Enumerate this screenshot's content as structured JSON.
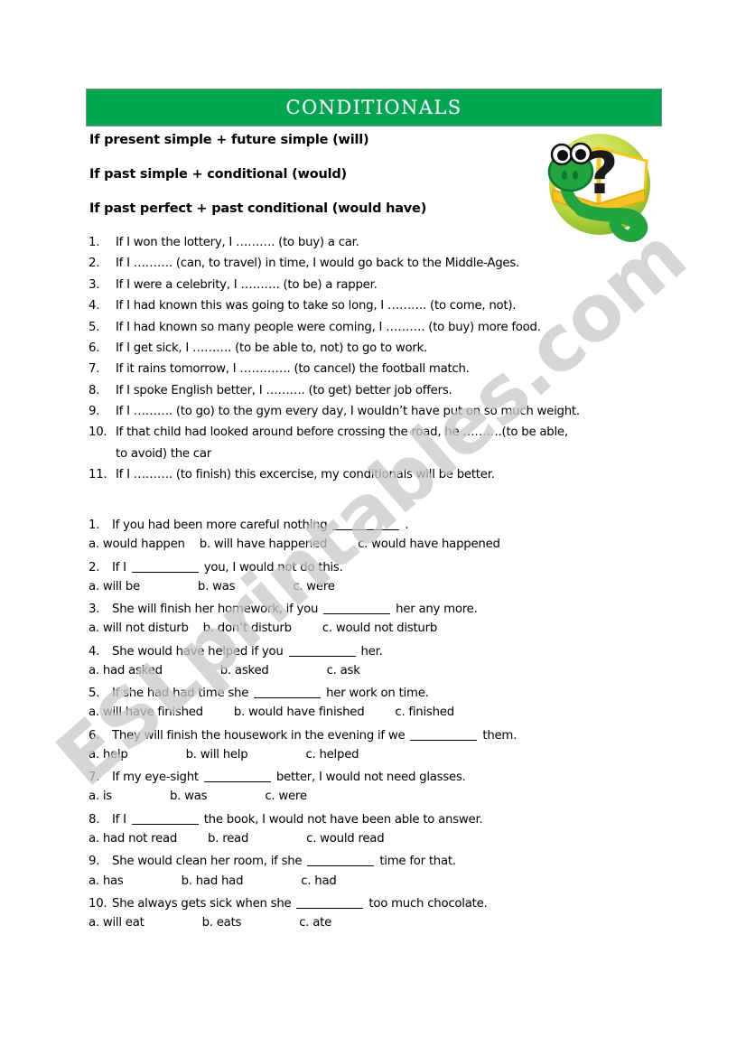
{
  "page": {
    "background_color": "#ffffff",
    "watermark": "ESLprintables.com"
  },
  "banner": {
    "title": "CONDITIONALS",
    "background_color": "#00a64f",
    "text_color": "#ffffff"
  },
  "clipart": {
    "name": "snake-with-book-question-mark",
    "circle_color": "#b5d334",
    "snake_color": "#15a03c",
    "book_color": "#ffffff",
    "book_edge_color": "#f5c518",
    "question_mark": "?"
  },
  "rules": [
    "If present simple + future simple (will)",
    "If past simple + conditional (would)",
    "If past perfect + past conditional (would have)"
  ],
  "exercise_one": {
    "items": [
      {
        "number": "1.",
        "text": "If I won the lottery, I ………. (to buy) a car."
      },
      {
        "number": "2.",
        "text": "If I ………. (can, to travel) in time, I would go back to the Middle-Ages."
      },
      {
        "number": "3.",
        "text": "If I were a celebrity, I ………. (to be) a rapper."
      },
      {
        "number": "4.",
        "text": "If I had known this was going to take so long, I ………. (to come, not)."
      },
      {
        "number": "5.",
        "text": "If I had known so many people were coming, I ………. (to buy) more food."
      },
      {
        "number": "6.",
        "text": "If I get sick, I ………. (to be able to, not) to go to work."
      },
      {
        "number": "7.",
        "text": "If it rains tomorrow, I …………. (to cancel) the football match."
      },
      {
        "number": "8.",
        "text": "If I spoke English better, I ………. (to get) better job offers."
      },
      {
        "number": "9.",
        "text": "If I ………. (to go) to the gym every day, I wouldn’t have put on so much weight."
      },
      {
        "number": "10.",
        "text": "If that child had looked around before crossing the road, he ……….(to be able, ",
        "continuation": "to avoid) the car"
      },
      {
        "number": "11.",
        "text": "If I ………. (to finish) this excercise, my conditionals will be better."
      }
    ]
  },
  "exercise_two": {
    "questions": [
      {
        "number": "1.",
        "stem_before": "If you had been more careful nothing",
        "stem_after": ".",
        "options": [
          "a. would happen",
          "b. will have happened",
          "c. would have happened"
        ],
        "gaps": [
          "sm",
          "md"
        ]
      },
      {
        "number": "2.",
        "stem_before": "If I",
        "stem_after": "you, I would not do this.",
        "options": [
          "a. will be",
          "b. was",
          "c. were"
        ],
        "gaps": [
          "lg",
          "lg"
        ]
      },
      {
        "number": "3.",
        "stem_before": "She will finish her homework, if you",
        "stem_after": "her any more.",
        "options": [
          "a. will not disturb",
          "b. don’t disturb",
          "c. would not disturb"
        ],
        "gaps": [
          "sm",
          "md"
        ]
      },
      {
        "number": "4.",
        "stem_before": "She would have helped if you",
        "stem_after": "her.",
        "options": [
          "a. had asked",
          "b. asked",
          "c. ask"
        ],
        "gaps": [
          "lg",
          "lg"
        ]
      },
      {
        "number": "5.",
        "stem_before": "If she had had time she",
        "stem_after": "her work on time.",
        "options": [
          "a. will have finished",
          "b. would have finished",
          "c. finished"
        ],
        "gaps": [
          "md",
          "md"
        ]
      },
      {
        "number": "6.",
        "stem_before": "They will finish the housework in the evening if we",
        "stem_after": "them.",
        "options": [
          "a. help",
          "b. will help",
          "c. helped"
        ],
        "gaps": [
          "lg",
          "lg"
        ]
      },
      {
        "number": "7.",
        "stem_before": "If my eye-sight",
        "stem_after": "better, I would not need glasses.",
        "options": [
          "a. is",
          "b. was",
          "c. were"
        ],
        "gaps": [
          "lg",
          "lg"
        ]
      },
      {
        "number": "8.",
        "stem_before": "If I",
        "stem_after": "the book, I would not have been able to answer.",
        "options": [
          "a. had not read",
          "b. read",
          "c. would read"
        ],
        "gaps": [
          "md",
          "lg"
        ]
      },
      {
        "number": "9.",
        "stem_before": "She would clean her room, if she",
        "stem_after": "time for that.",
        "options": [
          "a. has",
          "b. had had",
          "c. had"
        ],
        "gaps": [
          "lg",
          "lg"
        ]
      },
      {
        "number": "10.",
        "stem_before": "She always gets sick when she",
        "stem_after": "too much chocolate.",
        "options": [
          "a. will eat",
          "b. eats",
          "c. ate"
        ],
        "gaps": [
          "lg",
          "lg"
        ]
      }
    ]
  }
}
